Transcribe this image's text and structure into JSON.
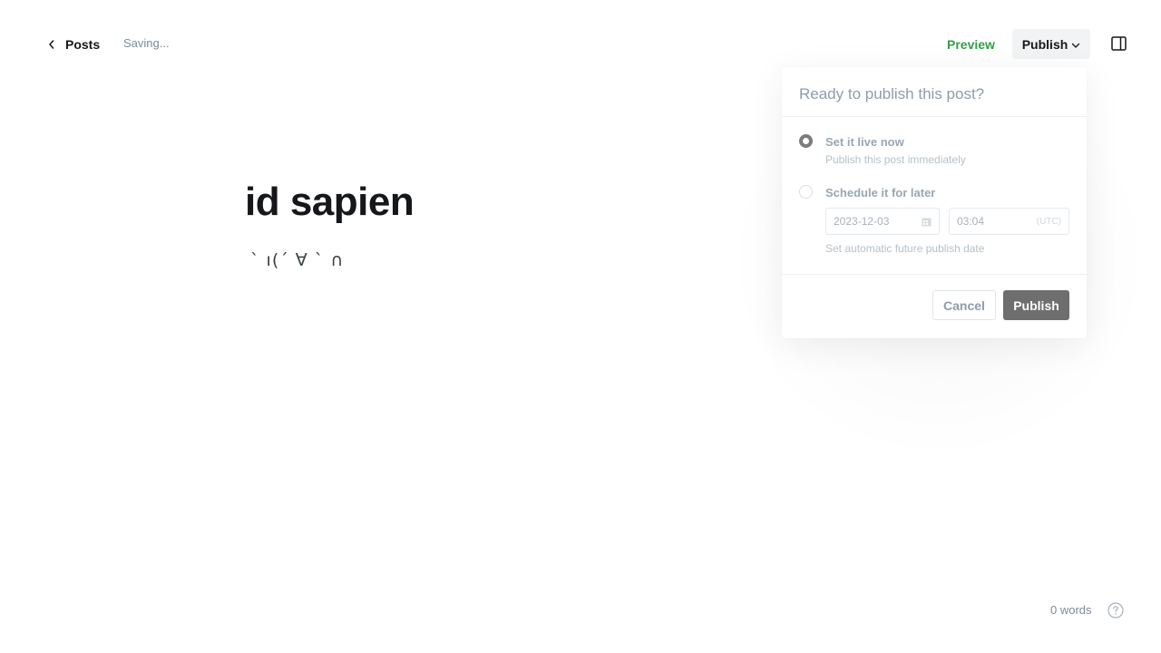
{
  "header": {
    "back_label": "Posts",
    "status": "Saving...",
    "preview_label": "Preview",
    "publish_label": "Publish"
  },
  "editor": {
    "title": "id sapien",
    "body": "ˋ ı(´ ∀ ˋ ∩"
  },
  "publish_menu": {
    "title": "Ready to publish this post?",
    "options": [
      {
        "label": "Set it live now",
        "description": "Publish this post immediately",
        "selected": true
      },
      {
        "label": "Schedule it for later",
        "description": "Set automatic future publish date",
        "selected": false,
        "date": "2023-12-03",
        "time": "03:04",
        "timezone": "(UTC)"
      }
    ],
    "cancel_label": "Cancel",
    "confirm_label": "Publish"
  },
  "footer": {
    "word_count": "0 words"
  },
  "colors": {
    "preview_green": "#30a046",
    "confirm_button": "#6e6e6e",
    "text_dark": "#15171a"
  },
  "icons": {
    "back": "chevron-left-icon",
    "publish_caret": "chevron-down-icon",
    "sidebar": "sidebar-toggle-icon",
    "calendar": "calendar-icon",
    "help": "question-circle-icon"
  }
}
